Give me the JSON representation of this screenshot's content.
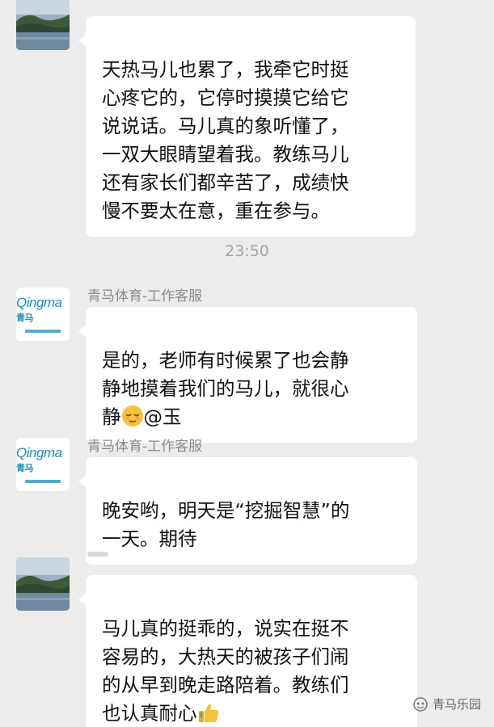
{
  "messages": [
    {
      "sender": "",
      "avatar": "landscape-avatar",
      "text": "天热马儿也累了，我牵它时挺\n心疼它的，它停时摸摸它给它\n说说话。马儿真的象听懂了，\n一双大眼睛望着我。教练马儿\n还有家长们都辛苦了，成绩快\n慢不要太在意，重在参与。"
    },
    {
      "timestamp": "23:50"
    },
    {
      "sender": "青马体育-工作客服",
      "avatar": "qingma-logo-avatar",
      "text": "是的，老师有时候累了也会静\n静地摸着我们的马儿，就很心\n静",
      "emoji": "relieved-face-emoji",
      "mention": "@玉"
    },
    {
      "sender": "青马体育-工作客服",
      "avatar": "qingma-logo-avatar",
      "text": "晚安哟，明天是“挖掘智慧”的\n一天。期待"
    },
    {
      "sender": "",
      "avatar": "landscape-avatar",
      "text": "马儿真的挺乖的，说实在挺不\n容易的，大热天的被孩子们闹\n的从早到晚走路陪着。教练们\n也认真耐心",
      "emoji": "thumbs-up-emoji"
    }
  ],
  "brand_logo": {
    "word": "Qingma",
    "cn": "青马"
  },
  "watermark": {
    "text": "青马乐园",
    "icon": "wechat-channel-icon"
  },
  "colors": {
    "background": "#ececec",
    "bubble": "#ffffff",
    "sender": "#8a8a8a",
    "brand": "#1f8fb8"
  }
}
